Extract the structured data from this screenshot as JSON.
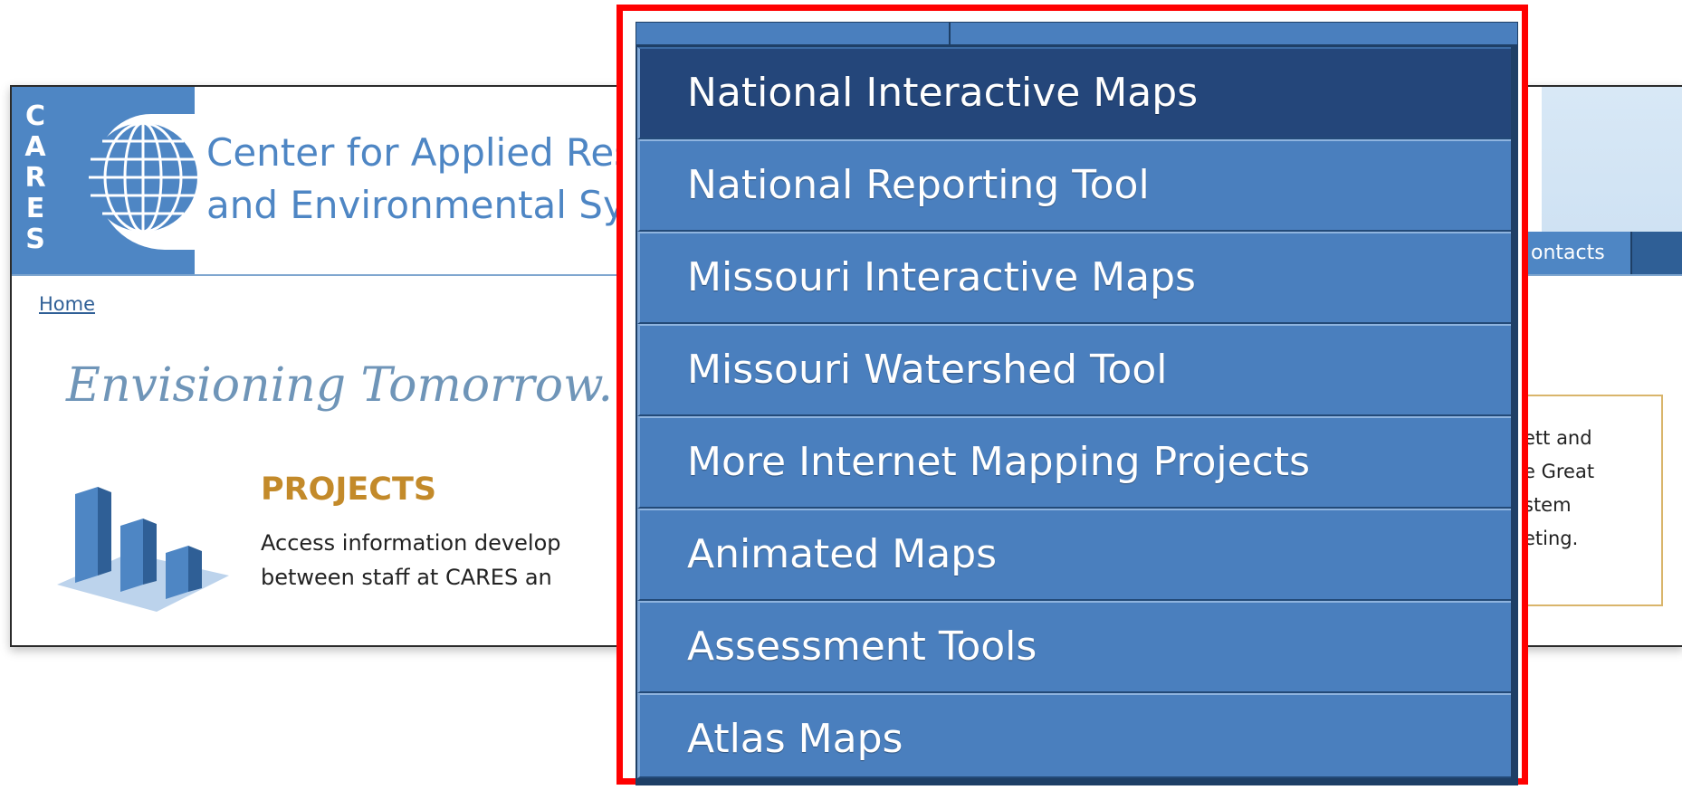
{
  "header": {
    "cares_letters": [
      "C",
      "A",
      "R",
      "E",
      "S"
    ],
    "title_line1": "Center for Applied Res",
    "title_line2": "and Environmental Syst",
    "nav_partial_label": "ontacts"
  },
  "breadcrumb": {
    "home_label": "Home"
  },
  "main": {
    "tagline": "Envisioning Tomorrow...",
    "projects": {
      "title": "PROJECTS",
      "description": "Access information develop\nbetween staff at CARES an"
    },
    "news_partial": "ett and\ne Great\nstem\neting."
  },
  "dropdown": {
    "items": [
      {
        "label": "National Interactive Maps",
        "active": true
      },
      {
        "label": "National Reporting Tool",
        "active": false
      },
      {
        "label": "Missouri Interactive Maps",
        "active": false
      },
      {
        "label": "Missouri Watershed Tool",
        "active": false
      },
      {
        "label": "More Internet Mapping Projects",
        "active": false
      },
      {
        "label": "Animated Maps",
        "active": false
      },
      {
        "label": "Assessment Tools",
        "active": false
      },
      {
        "label": "Atlas Maps",
        "active": false
      }
    ]
  },
  "colors": {
    "menu_bg": "#4a7fbe",
    "menu_active": "#24467a",
    "highlight_frame": "#ff0000",
    "brand_blue": "#4e86c4",
    "projects_gold": "#c38a2a"
  },
  "icons": {
    "globe": "globe-icon",
    "projects": "bar-chart-icon"
  }
}
